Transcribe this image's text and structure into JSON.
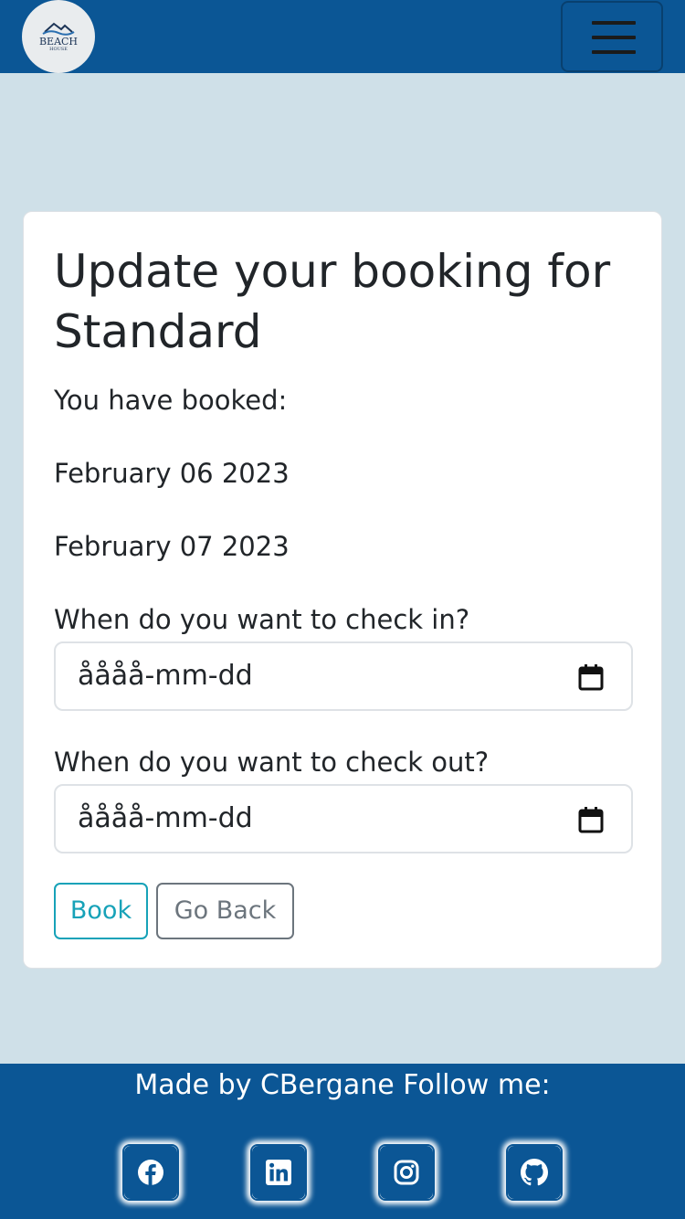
{
  "navbar": {
    "logo_text": "BEACH",
    "logo_subtext": "HOUSE",
    "menu_icon": "hamburger-icon"
  },
  "booking": {
    "title": "Update your booking for Standard",
    "booked_label": "You have booked:",
    "booked_dates": [
      "February 06 2023",
      "February 07 2023"
    ],
    "checkin_label": "When do you want to check in?",
    "checkin_value": "åååå-mm-dd",
    "checkout_label": "When do you want to check out?",
    "checkout_value": "åååå-mm-dd",
    "calendar_icon": "calendar-icon",
    "book_button": "Book",
    "back_button": "Go Back"
  },
  "footer": {
    "text": "Made by CBergane Follow me:",
    "social": [
      "facebook-icon",
      "linkedin-icon",
      "instagram-icon",
      "github-icon"
    ]
  },
  "colors": {
    "navbar_bg": "#0b5695",
    "page_bg": "#cfe0e8",
    "book_accent": "#17a2b8",
    "back_accent": "#6c757d"
  }
}
